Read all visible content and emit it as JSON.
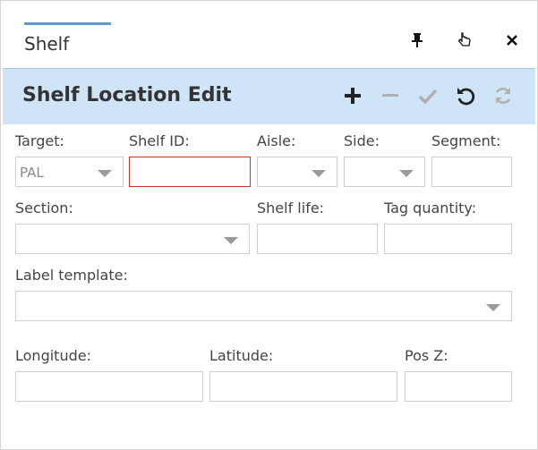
{
  "tab": {
    "title": "Shelf"
  },
  "window_icons": [
    "pin-icon",
    "pointer-icon",
    "close-icon"
  ],
  "panel": {
    "title": "Shelf Location Edit",
    "toolbar_icons": [
      "add-icon",
      "remove-icon",
      "confirm-icon",
      "undo-icon",
      "refresh-icon"
    ]
  },
  "form": {
    "target": {
      "label": "Target:",
      "value": "PAL"
    },
    "shelf_id": {
      "label": "Shelf ID:",
      "value": ""
    },
    "aisle": {
      "label": "Aisle:",
      "value": ""
    },
    "side": {
      "label": "Side:",
      "value": ""
    },
    "segment": {
      "label": "Segment:",
      "value": ""
    },
    "section": {
      "label": "Section:",
      "value": ""
    },
    "shelf_life": {
      "label": "Shelf life:",
      "value": ""
    },
    "tag_quantity": {
      "label": "Tag quantity:",
      "value": ""
    },
    "label_template": {
      "label": "Label template:",
      "value": ""
    },
    "longitude": {
      "label": "Longitude:",
      "value": ""
    },
    "latitude": {
      "label": "Latitude:",
      "value": ""
    },
    "pos_z": {
      "label": "Pos Z:",
      "value": ""
    }
  },
  "colors": {
    "panel_header_bg": "#cfe4f7",
    "tab_accent": "#5b9bd5",
    "error_border": "#c0392b",
    "disabled_icon": "#b0b0b0"
  }
}
